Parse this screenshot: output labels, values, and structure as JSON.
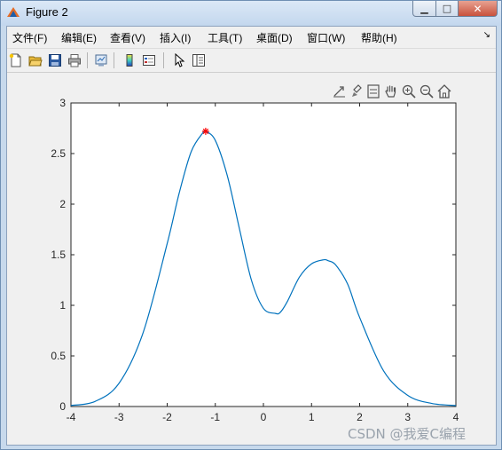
{
  "window": {
    "title": "Figure 2"
  },
  "controls": {
    "minimize": "▁",
    "maximize": "□",
    "close": "✕"
  },
  "menu": {
    "items": [
      "文件(F)",
      "编辑(E)",
      "查看(V)",
      "插入(I)",
      "工具(T)",
      "桌面(D)",
      "窗口(W)",
      "帮助(H)"
    ],
    "overflow_arrow": "↘"
  },
  "toolbar": {
    "icons": [
      "new-figure-icon",
      "open-folder-icon",
      "save-icon",
      "print-icon",
      "link-plot-icon",
      "colorbar-icon",
      "legend-icon",
      "pointer-arrow-icon",
      "property-inspector-icon"
    ]
  },
  "axes_toolbar": {
    "icons": [
      "export-icon",
      "brush-icon",
      "data-tips-icon",
      "pan-hand-icon",
      "zoom-in-icon",
      "zoom-out-icon",
      "home-icon"
    ]
  },
  "watermark": "CSDN @我爱C编程",
  "chart_data": {
    "type": "line",
    "title": "",
    "xlabel": "",
    "ylabel": "",
    "xlim": [
      -4,
      4
    ],
    "ylim": [
      0,
      3
    ],
    "xticks": [
      "-4",
      "-3",
      "-2",
      "-1",
      "0",
      "1",
      "2",
      "3",
      "4"
    ],
    "yticks": [
      "0",
      "0.5",
      "1",
      "1.5",
      "2",
      "2.5",
      "3"
    ],
    "grid": false,
    "series": [
      {
        "color": "#0072bd",
        "x": [
          -4,
          -3.5,
          -3,
          -2.5,
          -2,
          -1.75,
          -1.5,
          -1.25,
          -1.2,
          -1,
          -0.75,
          -0.5,
          -0.25,
          0,
          0.25,
          0.35,
          0.5,
          0.75,
          1,
          1.25,
          1.35,
          1.5,
          1.75,
          2,
          2.5,
          3,
          3.5,
          4
        ],
        "y": [
          0.01,
          0.05,
          0.23,
          0.73,
          1.61,
          2.11,
          2.52,
          2.71,
          2.72,
          2.63,
          2.28,
          1.76,
          1.25,
          0.97,
          0.92,
          0.93,
          1.04,
          1.28,
          1.41,
          1.45,
          1.44,
          1.4,
          1.21,
          0.88,
          0.35,
          0.11,
          0.03,
          0.01
        ]
      }
    ],
    "marker": {
      "x": -1.2,
      "y": 2.72,
      "symbol": "*",
      "color": "#ff0000"
    }
  }
}
